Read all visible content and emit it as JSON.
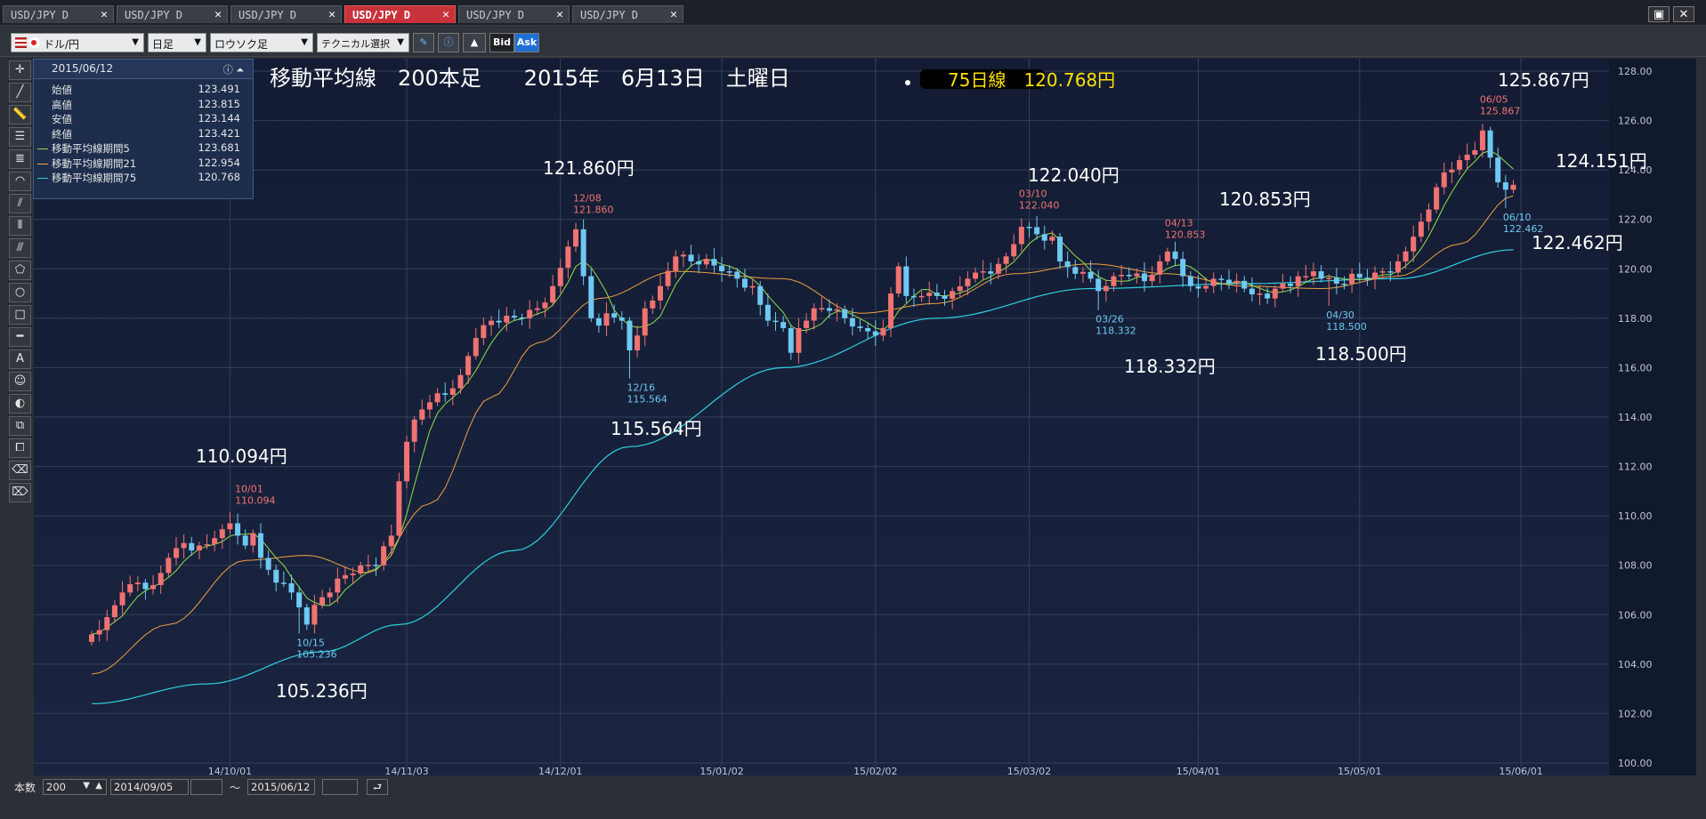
{
  "tabs": [
    {
      "label": "USD/JPY D",
      "active": false
    },
    {
      "label": "USD/JPY D",
      "active": false
    },
    {
      "label": "USD/JPY D",
      "active": false
    },
    {
      "label": "USD/JPY D",
      "active": true
    },
    {
      "label": "USD/JPY D",
      "active": false
    },
    {
      "label": "USD/JPY D",
      "active": false
    }
  ],
  "toolbar": {
    "pair": "ドル/円",
    "period": "日足",
    "chart_type": "ロウソク足",
    "technical": "テクニカル選択",
    "bid": "Bid",
    "ask": "Ask"
  },
  "info_panel": {
    "date": "2015/06/12",
    "rows": [
      {
        "label": "始値",
        "value": "123.491"
      },
      {
        "label": "高値",
        "value": "123.815"
      },
      {
        "label": "安値",
        "value": "123.144"
      },
      {
        "label": "終値",
        "value": "123.421"
      },
      {
        "label": "移動平均線期間5",
        "value": "123.681",
        "color": "#8fe04a"
      },
      {
        "label": "移動平均線期間21",
        "value": "122.954",
        "color": "#f0a040"
      },
      {
        "label": "移動平均線期間75",
        "value": "120.768",
        "color": "#2fd0e0"
      }
    ]
  },
  "bottom": {
    "count_label": "本数",
    "count_value": "200",
    "from_date": "2014/09/05",
    "tilde": "〜",
    "to_date": "2015/06/12"
  },
  "chart_data": {
    "type": "candlestick",
    "title": "移動平均線　200本足　　2015年　6月13日　土曜日",
    "note": "75日線　120.768円",
    "ylim": [
      100,
      128
    ],
    "yticks": [
      "100.00",
      "102.00",
      "104.00",
      "106.00",
      "108.00",
      "110.00",
      "112.00",
      "114.00",
      "116.00",
      "118.00",
      "120.00",
      "122.00",
      "124.00",
      "126.00",
      "128.00"
    ],
    "xticks": [
      {
        "label": "14/10/01",
        "i": 18
      },
      {
        "label": "14/11/03",
        "i": 41
      },
      {
        "label": "14/12/01",
        "i": 61
      },
      {
        "label": "15/01/02",
        "i": 82
      },
      {
        "label": "15/02/02",
        "i": 102
      },
      {
        "label": "15/03/02",
        "i": 122
      },
      {
        "label": "15/04/01",
        "i": 144
      },
      {
        "label": "15/05/01",
        "i": 165
      },
      {
        "label": "15/06/01",
        "i": 186
      }
    ],
    "ohlc_anchors": [
      [
        0,
        105.2
      ],
      [
        2,
        105.9
      ],
      [
        4,
        106.9
      ],
      [
        6,
        107.3
      ],
      [
        8,
        107.2
      ],
      [
        10,
        108.3
      ],
      [
        12,
        108.9
      ],
      [
        14,
        108.8
      ],
      [
        16,
        109.1
      ],
      [
        18,
        109.7
      ],
      [
        19,
        109.2
      ],
      [
        20,
        108.8
      ],
      [
        21,
        109.3
      ],
      [
        22,
        108.3
      ],
      [
        24,
        107.3
      ],
      [
        26,
        106.9
      ],
      [
        27,
        106.3
      ],
      [
        28,
        105.6
      ],
      [
        29,
        106.4
      ],
      [
        31,
        106.9
      ],
      [
        33,
        107.6
      ],
      [
        35,
        108.0
      ],
      [
        37,
        108.0
      ],
      [
        39,
        109.2
      ],
      [
        40,
        111.4
      ],
      [
        41,
        113.0
      ],
      [
        42,
        113.9
      ],
      [
        44,
        114.6
      ],
      [
        46,
        114.9
      ],
      [
        48,
        115.7
      ],
      [
        50,
        117.2
      ],
      [
        52,
        117.9
      ],
      [
        54,
        118.1
      ],
      [
        56,
        118.0
      ],
      [
        58,
        118.4
      ],
      [
        60,
        119.3
      ],
      [
        62,
        120.9
      ],
      [
        63,
        121.6
      ],
      [
        64,
        119.7
      ],
      [
        65,
        118.0
      ],
      [
        66,
        117.7
      ],
      [
        67,
        118.2
      ],
      [
        69,
        117.9
      ],
      [
        70,
        116.7
      ],
      [
        71,
        117.3
      ],
      [
        72,
        118.4
      ],
      [
        74,
        119.3
      ],
      [
        76,
        120.5
      ],
      [
        78,
        120.3
      ],
      [
        80,
        120.4
      ],
      [
        82,
        119.9
      ],
      [
        84,
        119.6
      ],
      [
        86,
        119.3
      ],
      [
        88,
        117.9
      ],
      [
        90,
        117.6
      ],
      [
        91,
        116.6
      ],
      [
        92,
        117.6
      ],
      [
        94,
        118.4
      ],
      [
        96,
        118.3
      ],
      [
        98,
        118.0
      ],
      [
        100,
        117.6
      ],
      [
        102,
        117.3
      ],
      [
        103,
        117.6
      ],
      [
        104,
        119.0
      ],
      [
        105,
        120.1
      ],
      [
        106,
        118.9
      ],
      [
        108,
        118.9
      ],
      [
        110,
        118.9
      ],
      [
        112,
        119.1
      ],
      [
        114,
        119.6
      ],
      [
        116,
        119.9
      ],
      [
        118,
        120.2
      ],
      [
        120,
        121.0
      ],
      [
        121,
        121.7
      ],
      [
        123,
        121.4
      ],
      [
        125,
        121.3
      ],
      [
        126,
        120.3
      ],
      [
        128,
        119.8
      ],
      [
        130,
        119.6
      ],
      [
        131,
        119.1
      ],
      [
        133,
        119.7
      ],
      [
        135,
        119.7
      ],
      [
        137,
        119.5
      ],
      [
        139,
        120.3
      ],
      [
        140,
        120.7
      ],
      [
        141,
        120.4
      ],
      [
        142,
        119.7
      ],
      [
        143,
        119.3
      ],
      [
        144,
        119.2
      ],
      [
        146,
        119.6
      ],
      [
        148,
        119.4
      ],
      [
        150,
        119.2
      ],
      [
        152,
        119.0
      ],
      [
        153,
        118.8
      ],
      [
        155,
        119.4
      ],
      [
        157,
        119.7
      ],
      [
        159,
        119.9
      ],
      [
        160,
        119.6
      ],
      [
        162,
        119.4
      ],
      [
        164,
        119.8
      ],
      [
        166,
        119.6
      ],
      [
        168,
        119.9
      ],
      [
        170,
        120.3
      ],
      [
        172,
        121.3
      ],
      [
        174,
        122.4
      ],
      [
        175,
        123.3
      ],
      [
        176,
        123.9
      ],
      [
        178,
        124.4
      ],
      [
        180,
        124.8
      ],
      [
        181,
        125.6
      ],
      [
        182,
        124.5
      ],
      [
        183,
        123.5
      ],
      [
        184,
        123.2
      ],
      [
        185,
        123.4
      ]
    ],
    "special": [
      {
        "i": 19,
        "high": 110.094
      },
      {
        "i": 27,
        "low": 105.236
      },
      {
        "i": 63,
        "high": 121.86
      },
      {
        "i": 70,
        "low": 115.564
      },
      {
        "i": 121,
        "high": 122.04
      },
      {
        "i": 131,
        "low": 118.332
      },
      {
        "i": 140,
        "high": 120.853
      },
      {
        "i": 161,
        "low": 118.5
      },
      {
        "i": 181,
        "high": 125.867
      },
      {
        "i": 184,
        "low": 122.462
      }
    ],
    "moving_averages": [
      {
        "name": "移動平均線期間5",
        "period": 5,
        "color": "#8fe04a"
      },
      {
        "name": "移動平均線期間21",
        "period": 21,
        "color": "#f0a040"
      },
      {
        "name": "移動平均線期間75",
        "period": 75,
        "color": "#2fd0e0"
      }
    ],
    "ma75_points": [
      [
        0,
        102.4
      ],
      [
        15,
        103.2
      ],
      [
        30,
        104.5
      ],
      [
        40,
        105.6
      ],
      [
        55,
        108.6
      ],
      [
        70,
        112.8
      ],
      [
        90,
        116.0
      ],
      [
        110,
        118.0
      ],
      [
        130,
        119.2
      ],
      [
        150,
        119.4
      ],
      [
        170,
        119.6
      ],
      [
        185,
        120.77
      ]
    ],
    "ma21_points": [
      [
        0,
        103.6
      ],
      [
        10,
        105.6
      ],
      [
        20,
        108.2
      ],
      [
        28,
        108.4
      ],
      [
        36,
        107.7
      ],
      [
        44,
        110.5
      ],
      [
        52,
        114.8
      ],
      [
        58,
        117.0
      ],
      [
        66,
        118.8
      ],
      [
        76,
        119.9
      ],
      [
        90,
        119.6
      ],
      [
        100,
        118.2
      ],
      [
        110,
        118.6
      ],
      [
        120,
        119.8
      ],
      [
        130,
        120.2
      ],
      [
        140,
        119.8
      ],
      [
        150,
        119.3
      ],
      [
        160,
        119.2
      ],
      [
        170,
        119.7
      ],
      [
        178,
        121.0
      ],
      [
        185,
        122.95
      ]
    ],
    "point_labels": [
      {
        "i": 19,
        "date": "10/01",
        "value": "110.094",
        "kind": "high"
      },
      {
        "i": 27,
        "date": "10/15",
        "value": "105.236",
        "kind": "low"
      },
      {
        "i": 63,
        "date": "12/08",
        "value": "121.860",
        "kind": "high"
      },
      {
        "i": 70,
        "date": "12/16",
        "value": "115.564",
        "kind": "low"
      },
      {
        "i": 121,
        "date": "03/10",
        "value": "122.040",
        "kind": "high"
      },
      {
        "i": 131,
        "date": "03/26",
        "value": "118.332",
        "kind": "low"
      },
      {
        "i": 140,
        "date": "04/13",
        "value": "120.853",
        "kind": "high"
      },
      {
        "i": 161,
        "date": "04/30",
        "value": "118.500",
        "kind": "low"
      },
      {
        "i": 181,
        "date": "06/05",
        "value": "125.867",
        "kind": "high"
      },
      {
        "i": 184,
        "date": "06/10",
        "value": "122.462",
        "kind": "low"
      }
    ],
    "annotations": [
      "110.094円",
      "105.236円",
      "121.860円",
      "115.564円",
      "122.040円",
      "118.332円",
      "120.853円",
      "118.500円",
      "125.867円",
      "124.151円",
      "122.462円"
    ]
  }
}
